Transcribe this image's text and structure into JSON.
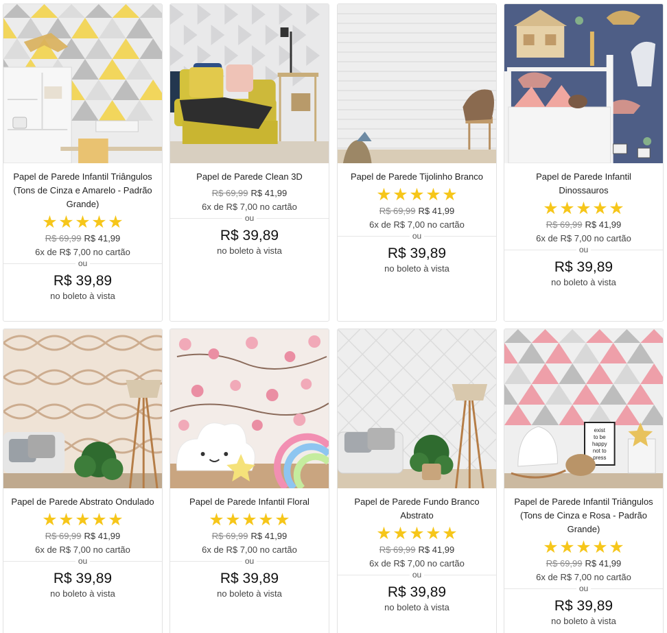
{
  "products": [
    {
      "title": "Papel de Parede Infantil Triângulos (Tons de Cinza e Amarelo - Padrão Grande)",
      "rating_stars": 5,
      "old_price": "R$ 69,99",
      "price": "R$ 41,99",
      "installments": "6x de R$ 7,00 no cartão",
      "or": "ou",
      "boleto_price": "R$ 39,89",
      "boleto_note": "no boleto à vista",
      "image": "yellow-grey-triangles-kids-room"
    },
    {
      "title": "Papel de Parede Clean 3D",
      "rating_stars": 0,
      "old_price": "R$ 69,99",
      "price": "R$ 41,99",
      "installments": "6x de R$ 7,00 no cartão",
      "or": "ou",
      "boleto_price": "R$ 39,89",
      "boleto_note": "no boleto à vista",
      "image": "white-3d-wall-yellow-armchair"
    },
    {
      "title": "Papel de Parede Tijolinho Branco",
      "rating_stars": 5,
      "old_price": "R$ 69,99",
      "price": "R$ 41,99",
      "installments": "6x de R$ 7,00 no cartão",
      "or": "ou",
      "boleto_price": "R$ 39,89",
      "boleto_note": "no boleto à vista",
      "image": "white-brick-wall-chair"
    },
    {
      "title": "Papel de Parede Infantil Dinossauros",
      "rating_stars": 5,
      "old_price": "R$ 69,99",
      "price": "R$ 41,99",
      "installments": "6x de R$ 7,00 no cartão",
      "or": "ou",
      "boleto_price": "R$ 39,89",
      "boleto_note": "no boleto à vista",
      "image": "blue-dinosaur-kids-room"
    },
    {
      "title": "Papel de Parede Abstrato Ondulado",
      "rating_stars": 5,
      "old_price": "R$ 69,99",
      "price": "R$ 41,99",
      "installments": "6x de R$ 7,00 no cartão",
      "or": "ou",
      "boleto_price": "R$ 39,89",
      "boleto_note": "no boleto à vista",
      "image": "beige-wave-pattern-living-room"
    },
    {
      "title": "Papel de Parede Infantil Floral",
      "rating_stars": 5,
      "old_price": "R$ 69,99",
      "price": "R$ 41,99",
      "installments": "6x de R$ 7,00 no cartão",
      "or": "ou",
      "boleto_price": "R$ 39,89",
      "boleto_note": "no boleto à vista",
      "image": "pink-floral-cloud-lamp"
    },
    {
      "title": "Papel de Parede Fundo Branco Abstrato",
      "rating_stars": 5,
      "old_price": "R$ 69,99",
      "price": "R$ 41,99",
      "installments": "6x de R$ 7,00 no cartão",
      "or": "ou",
      "boleto_price": "R$ 39,89",
      "boleto_note": "no boleto à vista",
      "image": "white-quilted-wall-sofa"
    },
    {
      "title": "Papel de Parede Infantil Triângulos (Tons de Cinza e Rosa - Padrão Grande)",
      "rating_stars": 5,
      "old_price": "R$ 69,99",
      "price": "R$ 41,99",
      "installments": "6x de R$ 7,00 no cartão",
      "or": "ou",
      "boleto_price": "R$ 39,89",
      "boleto_note": "no boleto à vista",
      "image": "pink-grey-triangles-kids-room"
    }
  ],
  "decor": {
    "poster_text": [
      "exist",
      "to be",
      "happy",
      "not to",
      "press"
    ]
  }
}
